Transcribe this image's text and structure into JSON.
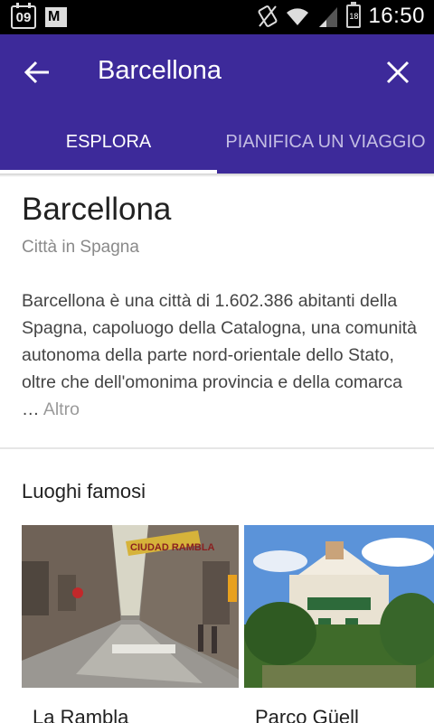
{
  "status_bar": {
    "calendar_day": "09",
    "battery_level": "18",
    "time": "16:50"
  },
  "toolbar": {
    "title": "Barcellona"
  },
  "tabs": [
    {
      "label": "ESPLORA",
      "active": true
    },
    {
      "label": "PIANIFICA UN VIAGGIO",
      "active": false
    }
  ],
  "place": {
    "title": "Barcellona",
    "subtitle": "Città in Spagna",
    "description": "Barcellona è una città di 1.602.386 abitanti della Spagna, capoluogo della Catalogna, una comunità autonoma della parte nord-orientale dello Stato, oltre che dell'omonima provincia e della comarca … ",
    "more_link": "Altro"
  },
  "famous_places": {
    "title": "Luoghi famosi",
    "items": [
      {
        "label": "La Rambla",
        "banner_text": "CIUDAD RAMBLA"
      },
      {
        "label": "Parco Güell"
      }
    ]
  }
}
